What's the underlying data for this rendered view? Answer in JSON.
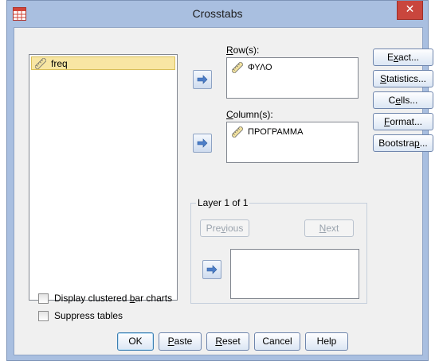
{
  "window": {
    "title": "Crosstabs",
    "close_glyph": "✕"
  },
  "source_list": {
    "items": [
      {
        "name": "freq",
        "icon": "ruler-icon",
        "selected": true
      }
    ]
  },
  "rows": {
    "label_prefix": "",
    "label_mnemonic": "R",
    "label_rest": "ow(s):",
    "items": [
      {
        "name": "ΦΥΛΟ",
        "icon": "ruler-icon"
      }
    ]
  },
  "columns": {
    "label_prefix": "",
    "label_mnemonic": "C",
    "label_rest": "olumn(s):",
    "items": [
      {
        "name": "ΠΡΟΓΡΑΜΜΑ",
        "icon": "ruler-icon"
      }
    ]
  },
  "side_buttons": {
    "exact": {
      "pre": "E",
      "mn": "x",
      "post": "act..."
    },
    "statistics": {
      "pre": "",
      "mn": "S",
      "post": "tatistics..."
    },
    "cells": {
      "pre": "C",
      "mn": "e",
      "post": "lls..."
    },
    "format": {
      "pre": "",
      "mn": "F",
      "post": "ormat..."
    },
    "bootstrap": {
      "pre": "Bootstra",
      "mn": "p",
      "post": "..."
    }
  },
  "layer": {
    "title": "Layer 1 of 1",
    "previous": {
      "pre": "Pre",
      "mn": "v",
      "post": "ious"
    },
    "next": {
      "pre": "",
      "mn": "N",
      "post": "ext"
    }
  },
  "options": {
    "clustered": {
      "pre": "Display clustered ",
      "mn": "b",
      "post": "ar charts",
      "checked": false
    },
    "suppress": {
      "pre": "Suppress tables",
      "mn": "",
      "post": "",
      "checked": false
    }
  },
  "buttons": {
    "ok": {
      "pre": "OK",
      "mn": "",
      "post": ""
    },
    "paste": {
      "pre": "",
      "mn": "P",
      "post": "aste"
    },
    "reset": {
      "pre": "",
      "mn": "R",
      "post": "eset"
    },
    "cancel": {
      "pre": "Cancel",
      "mn": "",
      "post": ""
    },
    "help": {
      "pre": "Help",
      "mn": "",
      "post": ""
    }
  },
  "colors": {
    "title_bar": "#a9bfe0",
    "close_red": "#c9463d",
    "selection": "#f8e6a3",
    "arrow_blue": "#4d7ec8"
  }
}
